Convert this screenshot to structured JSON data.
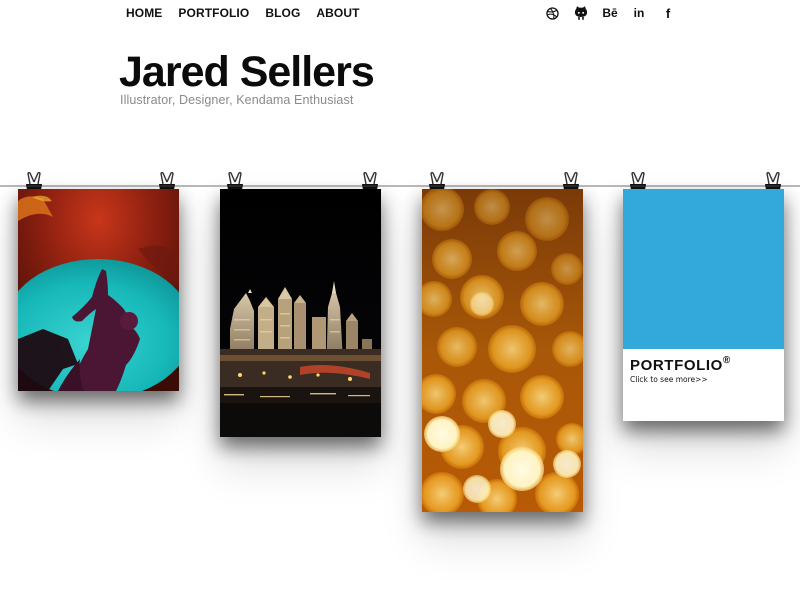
{
  "nav": {
    "home": "HOME",
    "portfolio": "PORTFOLIO",
    "blog": "BLOG",
    "about": "ABOUT"
  },
  "social": {
    "icons": [
      "dribbble-icon",
      "github-icon",
      "behance-icon",
      "linkedin-icon",
      "facebook-icon"
    ],
    "behance_text": "Bē",
    "linkedin_text": "in",
    "facebook_text": "f"
  },
  "header": {
    "title": "Jared Sellers",
    "tagline": "Illustrator, Designer, Kendama Enthusiast"
  },
  "gallery": {
    "photos": [
      {
        "subject": "abstract figure silhouette on teal and red"
      },
      {
        "subject": "Las Vegas New York-New York hotel skyline at night"
      },
      {
        "subject": "golden orange bokeh lights"
      },
      {
        "subject": "portfolio card"
      }
    ],
    "portfolio_card": {
      "label": "PORTFOLIO",
      "registered_mark": "®",
      "link_text": "Click to see more>>",
      "accent_color": "#33a8db"
    }
  },
  "colors": {
    "wire": "#b9b9b9",
    "tagline": "#8a8a8a",
    "text": "#111111"
  }
}
